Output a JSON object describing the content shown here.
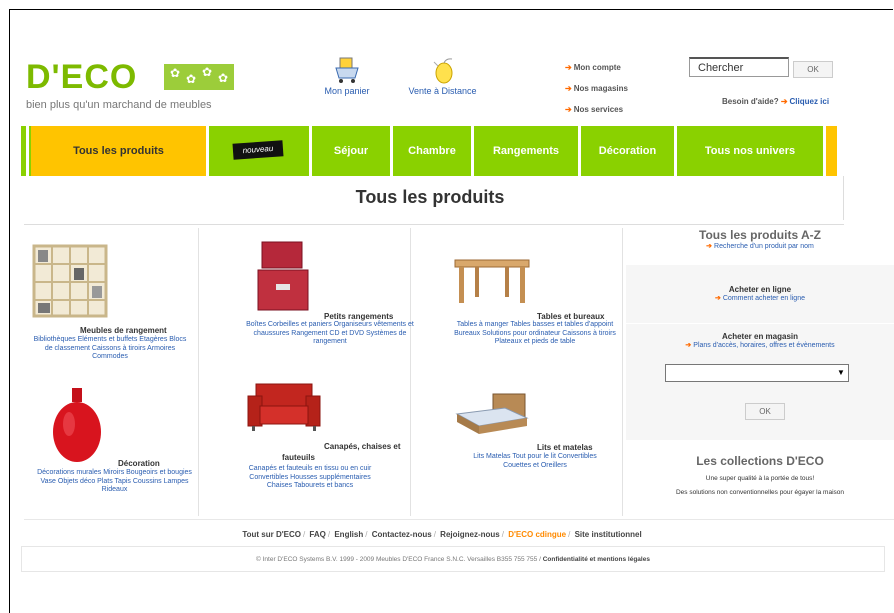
{
  "brand": {
    "logo": "D'ECO",
    "tagline": "bien plus qu'un marchand de meubles"
  },
  "header": {
    "panier": "Mon panier",
    "vente": "Vente à Distance",
    "links": [
      "Mon compte",
      "Nos magasins",
      "Nos services"
    ],
    "search_value": "Chercher",
    "search_button": "OK",
    "help_text": "Besoin d'aide?",
    "help_link": "Cliquez ici"
  },
  "nav": {
    "items": [
      "Tous les produits",
      "nouveau",
      "Séjour",
      "Chambre",
      "Rangements",
      "Décoration",
      "Tous nos univers"
    ]
  },
  "page_title": "Tous les produits",
  "products": [
    {
      "title": "Meubles de rangement",
      "links": "Bibliothèques Eléments et buffets Etagères Blocs de classement Caissons à tiroirs Armoires Commodes"
    },
    {
      "title": "Petits rangements",
      "links": "Boîtes Corbeilles et paniers Organiseurs vêtements et chaussures Rangement CD et DVD Systèmes de rangement"
    },
    {
      "title": "Tables et bureaux",
      "links": "Tables à manger Tables basses et tables d'appoint Bureaux Solutions pour ordinateur Caissons à tiroirs Plateaux et pieds de table"
    },
    {
      "title": "Décoration",
      "links": "Décorations murales Miroirs Bougeoirs et bougies Vase Objets déco Plats Tapis Coussins Lampes Rideaux"
    },
    {
      "title": "Canapés, chaises et fauteuils",
      "links": "Canapés et fauteuils en tissu ou en cuir Convertibles Housses supplémentaires Chaises Tabourets et bancs"
    },
    {
      "title": "Lits et matelas",
      "links": "Lits Matelas Tout pour le lit Convertibles Couettes et Oreillers"
    }
  ],
  "sidebar": {
    "az_title": "Tous les produits A-Z",
    "az_sub": "Recherche d'un produit par nom",
    "online_title": "Acheter en ligne",
    "online_sub": "Comment acheter en ligne",
    "store_title": "Acheter en magasin",
    "store_sub": "Plans d'accès, horaires, offres et évènements",
    "ok": "OK",
    "collections_title": "Les collections D'ECO",
    "collections_line1": "Une super qualité à la portée de tous!",
    "collections_line2": "Des solutions non conventionnelles pour égayer la maison"
  },
  "footer": {
    "links": [
      "Tout sur D'ECO",
      "FAQ",
      "English",
      "Contactez-nous",
      "Rejoignez-nous",
      "D'ECO cdingue",
      "Site institutionnel"
    ],
    "copyright": "© Inter D'ECO Systems B.V. 1999 - 2009 Meubles D'ECO France S.N.C. Versailles B355 755 755",
    "legal": "Confidentialité et mentions légales"
  },
  "colors": {
    "nav_green": "#8ad100",
    "active_yellow": "#ffc400",
    "link_blue": "#2a5db0",
    "arrow_orange": "#ff6a00"
  }
}
